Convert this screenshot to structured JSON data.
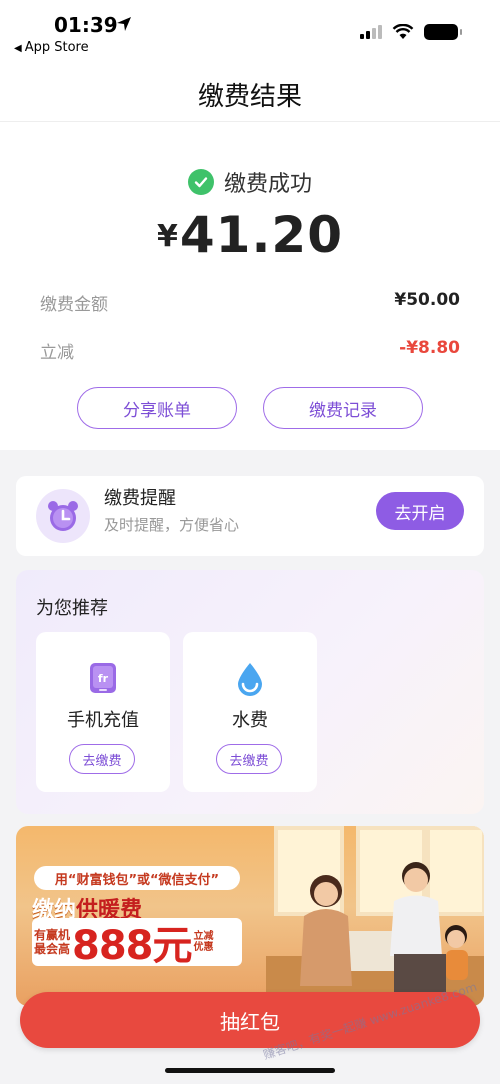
{
  "status_bar": {
    "time": "01:39",
    "back_app": "App Store"
  },
  "nav": {
    "title": "缴费结果"
  },
  "result": {
    "status": "缴费成功",
    "currency": "¥",
    "amount": "41.20",
    "rows": [
      {
        "label": "缴费金额",
        "value": "¥50.00"
      },
      {
        "label": "立减",
        "value": "-¥8.80"
      }
    ],
    "share_label": "分享账单",
    "records_label": "缴费记录"
  },
  "reminder": {
    "title": "缴费提醒",
    "subtitle": "及时提醒，方便省心",
    "button": "去开启"
  },
  "recommend": {
    "title": "为您推荐",
    "items": [
      {
        "name": "手机充值",
        "button": "去缴费",
        "icon": "phone-recharge-icon"
      },
      {
        "name": "水费",
        "button": "去缴费",
        "icon": "water-drop-icon"
      }
    ]
  },
  "banner": {
    "top_text": "用“财富钱包”或“微信支付”",
    "mid_text_a": "缴纳",
    "mid_text_b": "供暖费",
    "small_left": "有赢机最会高",
    "big": "888元",
    "small_right": "立减优惠"
  },
  "action": {
    "lottery_label": "抽红包"
  },
  "watermark": "赚客吧，有奖一起赚 www.zuanke8.com",
  "colors": {
    "accent": "#8e5ce4",
    "success": "#3fc26a",
    "danger": "#e8493f"
  }
}
